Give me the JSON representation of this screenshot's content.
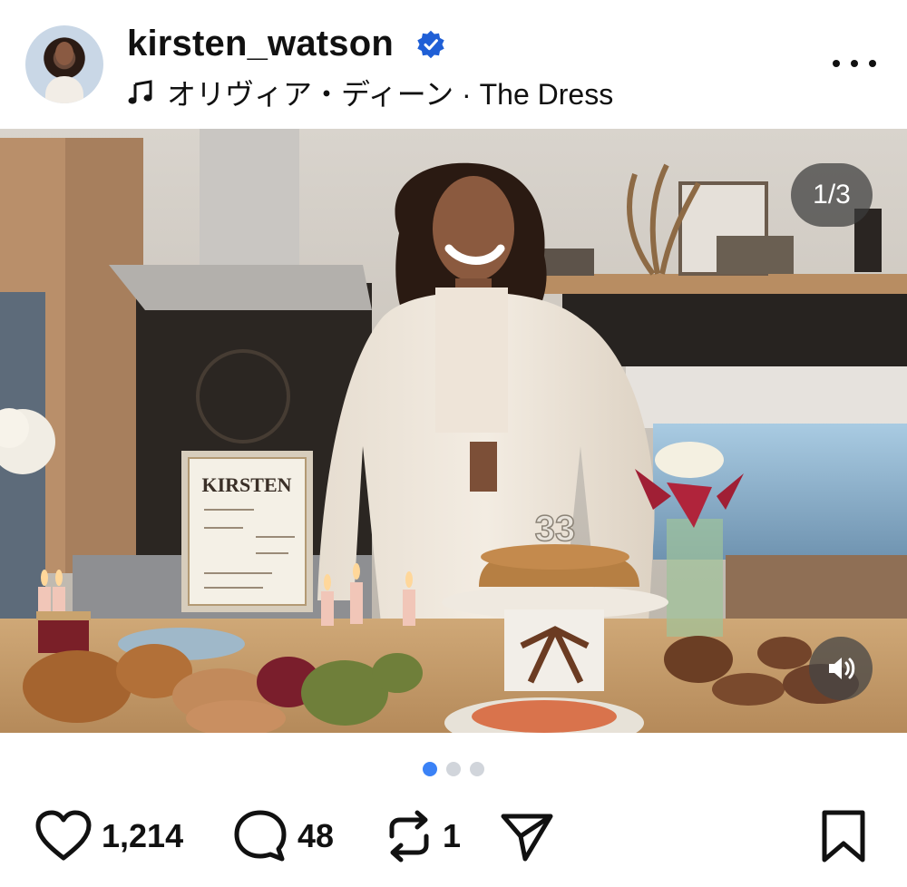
{
  "post": {
    "username": "kirsten_watson",
    "verified": true,
    "music": "オリヴィア・ディーン · The Dress",
    "more_icon": "more-horizontal-icon"
  },
  "media": {
    "counter": "1/3",
    "card_heading": "KIRSTEN",
    "candle_numbers": "33",
    "sound_icon": "volume-icon",
    "carousel_count": 3,
    "active_index": 0
  },
  "actions": {
    "likes": "1,214",
    "comments": "48",
    "reposts": "1",
    "like_icon": "heart-icon",
    "comment_icon": "comment-icon",
    "repost_icon": "repost-icon",
    "share_icon": "send-icon",
    "save_icon": "bookmark-icon"
  },
  "colors": {
    "verified": "#1f5fd6",
    "active_dot": "#3b82f6",
    "inactive_dot": "#d1d5db",
    "text": "#111111"
  }
}
